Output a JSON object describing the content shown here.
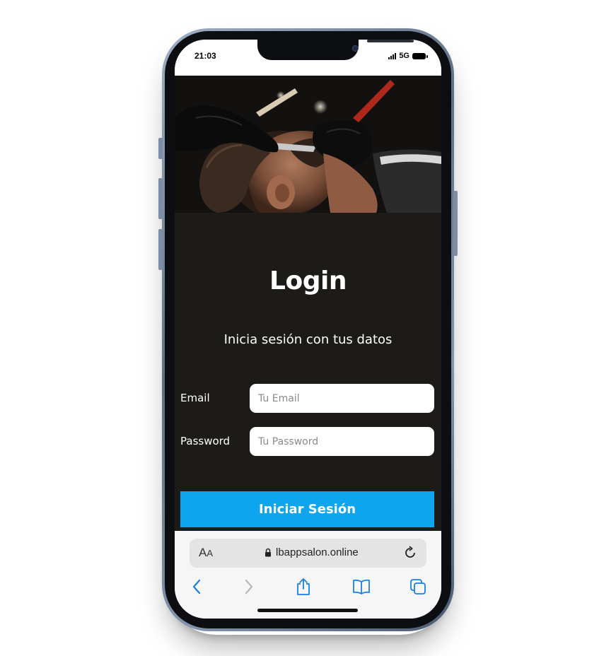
{
  "status_bar": {
    "time": "21:03",
    "network": "5G",
    "icons": [
      "signal-bars-icon",
      "battery-icon"
    ]
  },
  "hero": {
    "icon": "barber-shaving-photo"
  },
  "login": {
    "title": "Login",
    "subtitle": "Inicia sesión con tus datos",
    "email_label": "Email",
    "email_placeholder": "Tu Email",
    "email_value": "",
    "password_label": "Password",
    "password_placeholder": "Tu Password",
    "password_value": "",
    "submit_label": "Iniciar Sesión"
  },
  "browser": {
    "text_size_label_big": "A",
    "text_size_label_small": "A",
    "url": "lbappsalon.online",
    "nav_icons": [
      "back-chevron-icon",
      "forward-chevron-icon",
      "share-icon",
      "bookmarks-icon",
      "tabs-icon"
    ]
  },
  "colors": {
    "panel_background": "#1c1b17",
    "button_background": "#0ea5ef",
    "accent": "#1a7fe0"
  }
}
